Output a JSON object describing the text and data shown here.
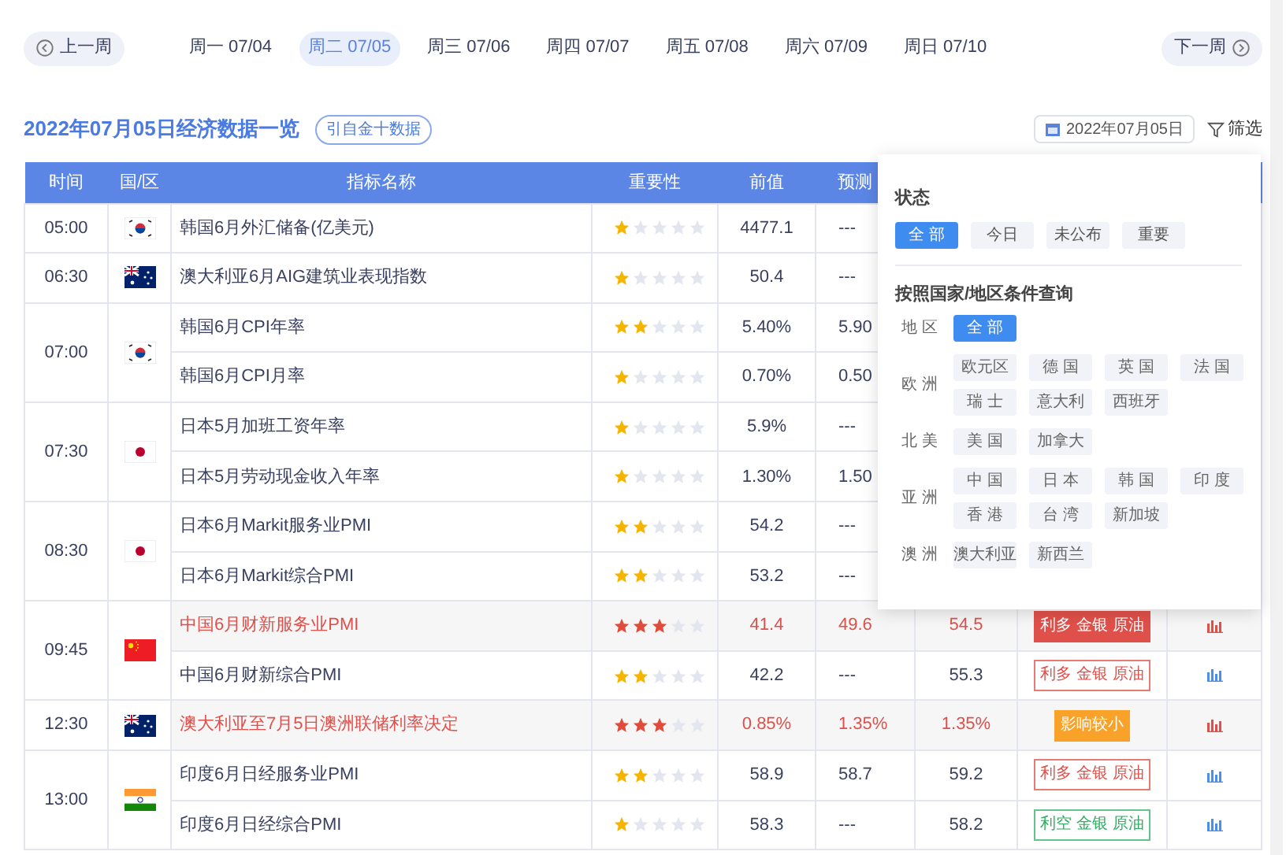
{
  "week_nav": {
    "prev": "上一周",
    "next": "下一周",
    "days": [
      {
        "label": "周一 07/04",
        "selected": false
      },
      {
        "label": "周二 07/05",
        "selected": true
      },
      {
        "label": "周三 07/06",
        "selected": false
      },
      {
        "label": "周四 07/07",
        "selected": false
      },
      {
        "label": "周五 07/08",
        "selected": false
      },
      {
        "label": "周六 07/09",
        "selected": false
      },
      {
        "label": "周日 07/10",
        "selected": false
      }
    ]
  },
  "header": {
    "title": "2022年07月05日经济数据一览",
    "source": "引自金十数据",
    "date": "2022年07月05日",
    "filter": "筛选"
  },
  "table": {
    "columns": [
      "时间",
      "国/区",
      "指标名称",
      "重要性",
      "前值",
      "预测"
    ],
    "groups": [
      {
        "time": "05:00",
        "kind": "kr",
        "events": [
          {
            "name": "韩国6月外汇储备(亿美元)",
            "stars": 1,
            "previous": "4477.1",
            "forecast": "---",
            "highlight": false
          }
        ]
      },
      {
        "time": "06:30",
        "kind": "au",
        "events": [
          {
            "name": "澳大利亚6月AIG建筑业表现指数",
            "stars": 1,
            "previous": "50.4",
            "forecast": "---",
            "highlight": false
          }
        ]
      },
      {
        "time": "07:00",
        "kind": "kr",
        "events": [
          {
            "name": "韩国6月CPI年率",
            "stars": 2,
            "previous": "5.40%",
            "forecast": "5.90",
            "highlight": false
          },
          {
            "name": "韩国6月CPI月率",
            "stars": 1,
            "previous": "0.70%",
            "forecast": "0.50",
            "highlight": false
          }
        ]
      },
      {
        "time": "07:30",
        "kind": "jp",
        "events": [
          {
            "name": "日本5月加班工资年率",
            "stars": 1,
            "previous": "5.9%",
            "forecast": "---",
            "highlight": false
          },
          {
            "name": "日本5月劳动现金收入年率",
            "stars": 1,
            "previous": "1.30%",
            "forecast": "1.50",
            "highlight": false
          }
        ]
      },
      {
        "time": "08:30",
        "kind": "jp",
        "events": [
          {
            "name": "日本6月Markit服务业PMI",
            "stars": 2,
            "previous": "54.2",
            "forecast": "---",
            "highlight": false
          },
          {
            "name": "日本6月Markit综合PMI",
            "stars": 2,
            "previous": "53.2",
            "forecast": "---",
            "highlight": false
          }
        ]
      },
      {
        "time": "09:45",
        "kind": "cn",
        "events": [
          {
            "name": "中国6月财新服务业PMI",
            "stars": 3,
            "previous": "41.4",
            "forecast": "49.6",
            "actual": "54.5",
            "impact": {
              "text": "利多 金银 原油",
              "kind": "strong"
            },
            "highlight": true
          },
          {
            "name": "中国6月财新综合PMI",
            "stars": 2,
            "previous": "42.2",
            "forecast": "---",
            "actual": "55.3",
            "impact": {
              "text": "利多 金银 原油",
              "kind": "bullish"
            },
            "highlight": false
          }
        ]
      },
      {
        "time": "12:30",
        "kind": "au",
        "events": [
          {
            "name": "澳大利亚至7月5日澳洲联储利率决定",
            "stars": 3,
            "previous": "0.85%",
            "forecast": "1.35%",
            "actual": "1.35%",
            "impact": {
              "text": "影响较小",
              "kind": "minor"
            },
            "highlight": true
          }
        ]
      },
      {
        "time": "13:00",
        "kind": "in",
        "events": [
          {
            "name": "印度6月日经服务业PMI",
            "stars": 2,
            "previous": "58.9",
            "forecast": "58.7",
            "actual": "59.2",
            "impact": {
              "text": "利多 金银 原油",
              "kind": "bullish"
            },
            "highlight": false
          },
          {
            "name": "印度6月日经综合PMI",
            "stars": 1,
            "previous": "58.3",
            "forecast": "---",
            "actual": "58.2",
            "impact": {
              "text": "利空 金银 原油",
              "kind": "bearish"
            },
            "highlight": false
          }
        ]
      }
    ]
  },
  "filter_panel": {
    "status_title": "状态",
    "status": [
      {
        "label": "全 部",
        "selected": true
      },
      {
        "label": "今日",
        "selected": false
      },
      {
        "label": "未公布",
        "selected": false
      },
      {
        "label": "重要",
        "selected": false
      }
    ],
    "region_title": "按照国家/地区条件查询",
    "regions": [
      {
        "label": "地 区",
        "chips": [
          {
            "label": "全 部",
            "selected": true
          }
        ]
      },
      {
        "label": "欧 洲",
        "chips": [
          {
            "label": "欧元区",
            "selected": false
          },
          {
            "label": "德 国",
            "selected": false
          },
          {
            "label": "英 国",
            "selected": false
          },
          {
            "label": "法 国",
            "selected": false
          },
          {
            "label": "瑞 士",
            "selected": false
          },
          {
            "label": "意大利",
            "selected": false
          },
          {
            "label": "西班牙",
            "selected": false
          }
        ]
      },
      {
        "label": "北 美",
        "chips": [
          {
            "label": "美 国",
            "selected": false
          },
          {
            "label": "加拿大",
            "selected": false
          }
        ]
      },
      {
        "label": "亚 洲",
        "chips": [
          {
            "label": "中 国",
            "selected": false
          },
          {
            "label": "日 本",
            "selected": false
          },
          {
            "label": "韩 国",
            "selected": false
          },
          {
            "label": "印 度",
            "selected": false
          },
          {
            "label": "香 港",
            "selected": false
          },
          {
            "label": "台 湾",
            "selected": false
          },
          {
            "label": "新加坡",
            "selected": false
          }
        ]
      },
      {
        "label": "澳 洲",
        "chips": [
          {
            "label": "澳大利亚",
            "selected": false
          },
          {
            "label": "新西兰",
            "selected": false
          }
        ]
      }
    ]
  }
}
